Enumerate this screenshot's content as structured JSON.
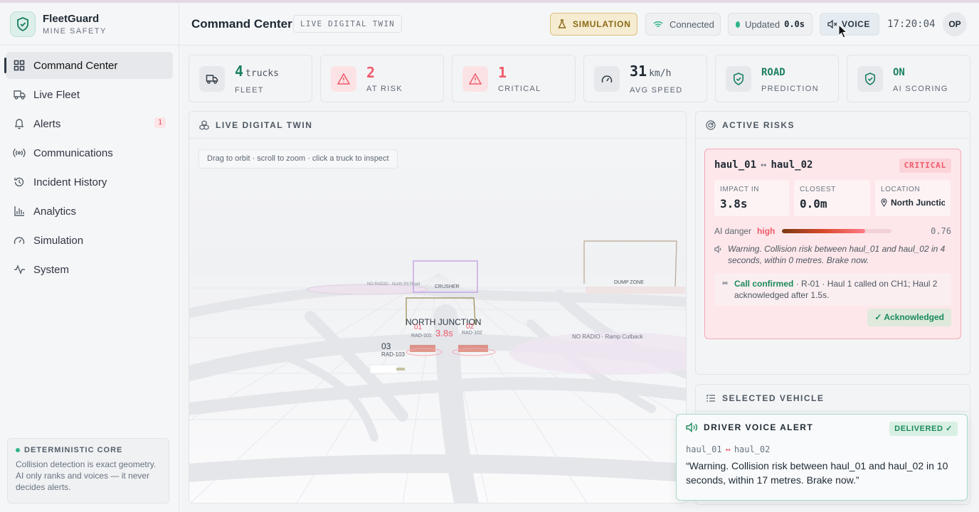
{
  "brand": {
    "name": "FleetGuard",
    "subtitle": "MINE SAFETY"
  },
  "sidebar": {
    "items": [
      {
        "label": "Command Center",
        "icon": "grid-icon",
        "active": true
      },
      {
        "label": "Live Fleet",
        "icon": "truck-icon"
      },
      {
        "label": "Alerts",
        "icon": "bell-icon",
        "badge": "1"
      },
      {
        "label": "Communications",
        "icon": "radio-icon"
      },
      {
        "label": "Incident History",
        "icon": "history-icon"
      },
      {
        "label": "Analytics",
        "icon": "bar-chart-icon"
      },
      {
        "label": "Simulation",
        "icon": "gauge-icon"
      },
      {
        "label": "System",
        "icon": "pulse-icon"
      }
    ],
    "core": {
      "title": "DETERMINISTIC CORE",
      "text": "Collision detection is exact geometry. AI only ranks and voices — it never decides alerts."
    }
  },
  "header": {
    "title": "Command Center",
    "tag": "LIVE DIGITAL TWIN",
    "simulation": "SIMULATION",
    "connection": "Connected",
    "updated_label": "Updated",
    "updated_value": "0.0s",
    "voice": "VOICE",
    "clock": "17:20:04",
    "avatar": "OP"
  },
  "kpis": [
    {
      "value": "4",
      "unit": "trucks",
      "label": "FLEET",
      "icon": "truck-icon"
    },
    {
      "value": "2",
      "unit": "",
      "label": "AT RISK",
      "icon": "warning-icon"
    },
    {
      "value": "1",
      "unit": "",
      "label": "CRITICAL",
      "icon": "warning-icon"
    },
    {
      "value": "31",
      "unit": "km/h",
      "label": "AVG SPEED",
      "icon": "gauge-icon"
    },
    {
      "value": "ROAD",
      "unit": "",
      "label": "PREDICTION",
      "icon": "shield-icon"
    },
    {
      "value": "ON",
      "unit": "",
      "label": "AI SCORING",
      "icon": "shield-icon"
    }
  ],
  "twin": {
    "title": "LIVE DIGITAL TWIN",
    "hint": "Drag to orbit · scroll to zoom · click a truck to inspect",
    "labels": {
      "no_radio_1": "NO RADIO · North Pit Road",
      "crusher": "CRUSHER",
      "dump": "DUMP ZONE",
      "junction": "NORTH JUNCTION",
      "no_radio_2": "NO RADIO · Ramp Cutback",
      "t1": "01",
      "t1_rad": "RAD-101",
      "t2": "02",
      "t2_rad": "RAD-102",
      "t3": "03",
      "t3_rad": "RAD-103",
      "ttc": "3.8s"
    }
  },
  "risks": {
    "title": "ACTIVE RISKS",
    "a": "haul_01",
    "arrow": "↔",
    "b": "haul_02",
    "severity": "CRITICAL",
    "impact_label": "IMPACT IN",
    "impact_value": "3.8s",
    "closest_label": "CLOSEST",
    "closest_value": "0.0m",
    "location_label": "LOCATION",
    "location_value": "North Junction",
    "danger_label": "AI danger",
    "danger_level": "high",
    "danger_value": "0.76",
    "danger_fraction": 0.76,
    "warning": "Warning. Collision risk between haul_01 and haul_02 in 4 seconds, within 0 metres. Brake now.",
    "call_status": "Call confirmed",
    "call_text": " · R-01 · Haul 1 called on CH1; Haul 2 acknowledged after 1.5s.",
    "ack": "✓  Acknowledged"
  },
  "selected": {
    "title": "SELECTED VEHICLE"
  },
  "toast": {
    "title": "DRIVER VOICE ALERT",
    "status": "DELIVERED ✓",
    "a": "haul_01",
    "arrow": "↔",
    "b": "haul_02",
    "message": "“Warning. Collision risk between haul_01 and haul_02 in 10 seconds, within 17 metres. Brake now.”"
  },
  "colors": {
    "accent": "#1b7f62",
    "critical": "#ef5a6a",
    "sim": "#d8c07b"
  }
}
